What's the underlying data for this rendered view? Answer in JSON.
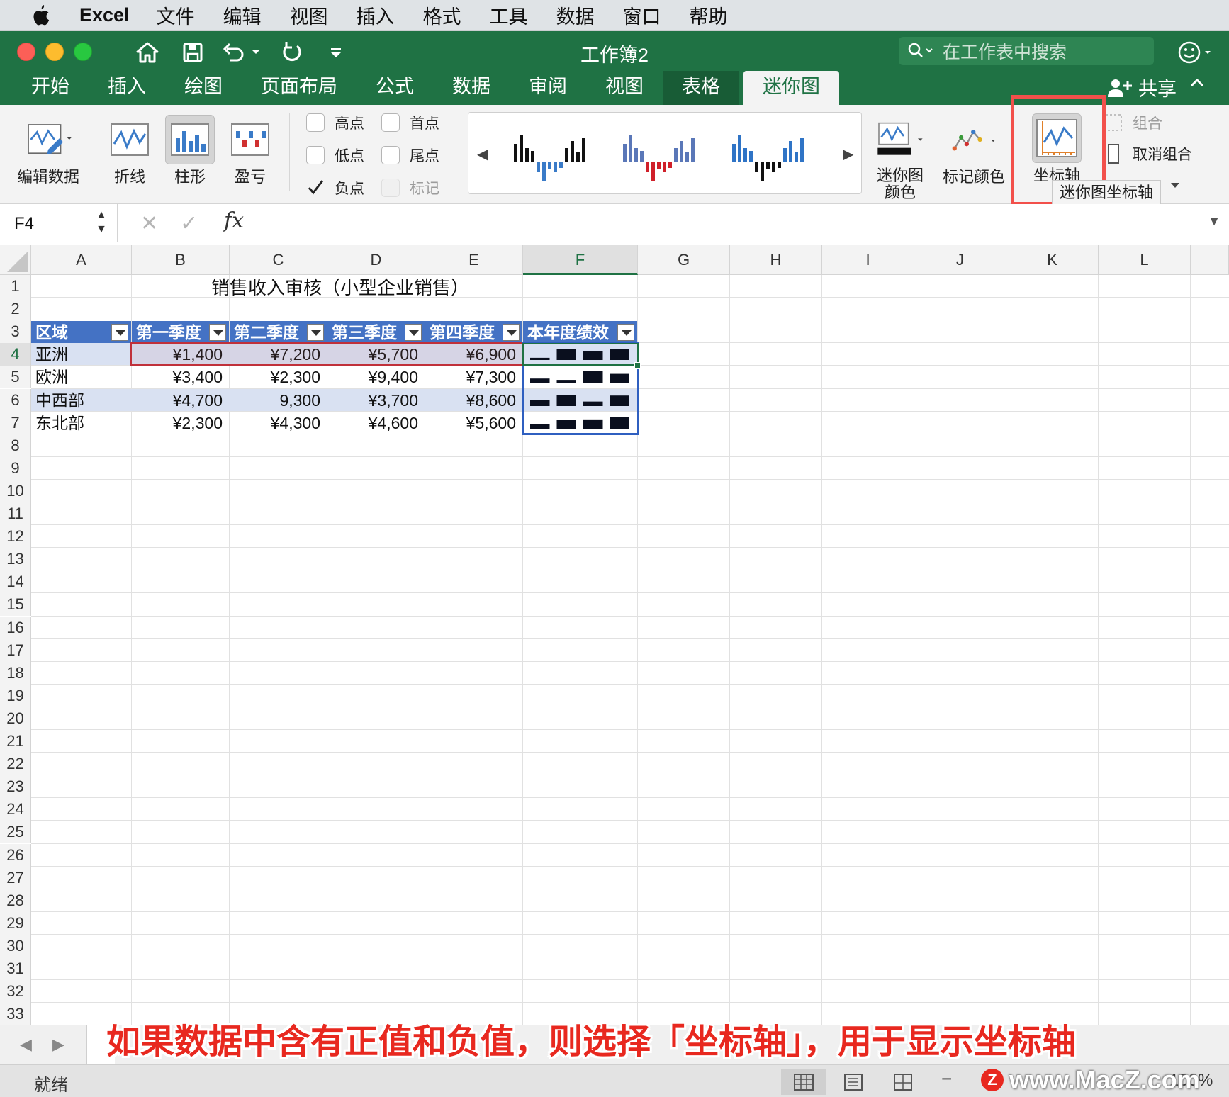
{
  "menubar": {
    "app": "Excel",
    "items": [
      "文件",
      "编辑",
      "视图",
      "插入",
      "格式",
      "工具",
      "数据",
      "窗口",
      "帮助"
    ]
  },
  "titlebar": {
    "title": "工作簿2",
    "search_placeholder": "在工作表中搜索"
  },
  "ribbon_tabs": [
    "开始",
    "插入",
    "绘图",
    "页面布局",
    "公式",
    "数据",
    "审阅",
    "视图",
    "表格",
    "迷你图"
  ],
  "active_tab": "迷你图",
  "share_label": "共享",
  "ribbon": {
    "edit_data": "编辑数据",
    "type_line": "折线",
    "type_column": "柱形",
    "type_winloss": "盈亏",
    "show": [
      {
        "label": "高点",
        "checked": false,
        "enabled": true
      },
      {
        "label": "首点",
        "checked": false,
        "enabled": true
      },
      {
        "label": "低点",
        "checked": false,
        "enabled": true
      },
      {
        "label": "尾点",
        "checked": false,
        "enabled": true
      },
      {
        "label": "负点",
        "checked": true,
        "enabled": true
      },
      {
        "label": "标记",
        "checked": false,
        "enabled": false
      }
    ],
    "sparkline_color_l1": "迷你图",
    "sparkline_color_l2": "颜色",
    "marker_color": "标记颜色",
    "axis": "坐标轴",
    "group": "组合",
    "ungroup": "取消组合",
    "tooltip": "迷你图坐标轴"
  },
  "formula_bar": {
    "name_box": "F4",
    "fx": "fx",
    "formula": ""
  },
  "columns": [
    "A",
    "B",
    "C",
    "D",
    "E",
    "F",
    "G",
    "H",
    "I",
    "J",
    "K",
    "L"
  ],
  "rows": [
    "1",
    "2",
    "3",
    "4",
    "5",
    "6",
    "7",
    "8",
    "9",
    "10",
    "11",
    "12",
    "13",
    "14",
    "15",
    "16",
    "17",
    "18",
    "19",
    "20",
    "21",
    "22",
    "23",
    "24",
    "25",
    "26",
    "27",
    "28",
    "29",
    "30",
    "31",
    "32",
    "33"
  ],
  "sheet": {
    "title": "销售收入审核（小型企业销售）",
    "headers": [
      "区域",
      "第一季度",
      "第二季度",
      "第三季度",
      "第四季度",
      "本年度绩效"
    ],
    "data": [
      {
        "region": "亚洲",
        "q1": "¥1,400",
        "q2": "¥7,200",
        "q3": "¥5,700",
        "q4": "¥6,900"
      },
      {
        "region": "欧洲",
        "q1": "¥3,400",
        "q2": "¥2,300",
        "q3": "¥9,400",
        "q4": "¥7,300"
      },
      {
        "region": "中西部",
        "q1": "¥4,700",
        "q2": "9,300",
        "q3": "¥3,700",
        "q4": "¥8,600"
      },
      {
        "region": "东北部",
        "q1": "¥2,300",
        "q2": "¥4,300",
        "q3": "¥4,600",
        "q4": "¥5,600"
      }
    ]
  },
  "sparkline_values": [
    [
      1400,
      7200,
      5700,
      6900
    ],
    [
      3400,
      2300,
      9400,
      7300
    ],
    [
      4700,
      9300,
      3700,
      8600
    ],
    [
      2300,
      4300,
      4600,
      5600
    ]
  ],
  "caption": "如果数据中含有正值和负值，则选择「坐标轴」，用于显示坐标轴",
  "status": "就绪",
  "zoom_text": "100%",
  "watermark": "www.MacZ.com",
  "watermark_logo": "Z",
  "colors": {
    "excel_green": "#1f7244",
    "table_header": "#4472c4",
    "band": "#d9e1f2",
    "highlight": "#f2504b",
    "caption": "#e8281f"
  }
}
